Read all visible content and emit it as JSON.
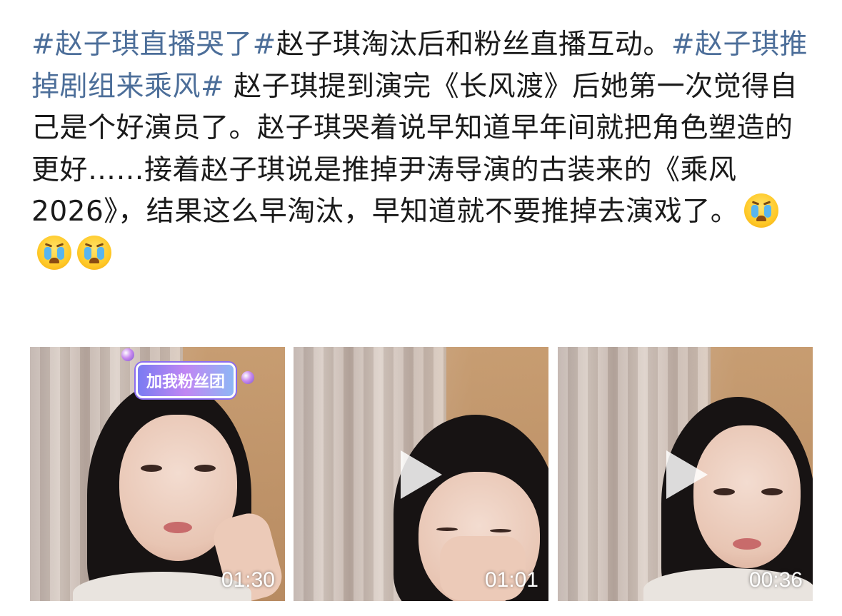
{
  "post": {
    "segments": [
      {
        "text": "#赵子琪直播哭了#",
        "type": "hashtag"
      },
      {
        "text": "赵子琪淘汰后和粉丝直播互动。",
        "type": "text"
      },
      {
        "text": "#赵子琪推掉剧组来乘风#",
        "type": "hashtag"
      },
      {
        "text": " 赵子琪提到演完《长风渡》后她第一次觉得自己是个好演员了。赵子琪哭着说早知道早年间就把角色塑造的更好……接着赵子琪说是推掉尹涛导演的古装来的《乘风 2026》，结果这么早淘汰，早知道就不要推掉去演戏了。",
        "type": "text"
      }
    ],
    "emojis": [
      "crying-face-icon",
      "crying-face-icon",
      "crying-face-icon"
    ]
  },
  "videos": [
    {
      "duration": "01:30",
      "badge": "加我粉丝团",
      "has_play_icon": false
    },
    {
      "duration": "01:01",
      "has_play_icon": true
    },
    {
      "duration": "00:36",
      "has_play_icon": true
    }
  ],
  "colors": {
    "hashtag": "#4c6e99",
    "text": "#1a1a1a"
  }
}
